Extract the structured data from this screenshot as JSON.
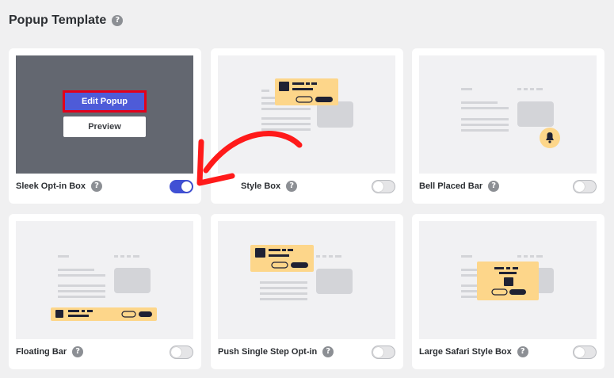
{
  "page": {
    "title": "Popup Template",
    "help_glyph": "?"
  },
  "cards": [
    {
      "name": "Sleek Opt-in Box",
      "enabled": true,
      "hovered": true
    },
    {
      "name": "Style Box",
      "enabled": false
    },
    {
      "name": "Bell Placed Bar",
      "enabled": false
    },
    {
      "name": "Floating Bar",
      "enabled": false
    },
    {
      "name": "Push Single Step Opt-in",
      "enabled": false
    },
    {
      "name": "Large Safari Style Box",
      "enabled": false
    }
  ],
  "hover_actions": {
    "edit_label": "Edit Popup",
    "preview_label": "Preview"
  },
  "colors": {
    "accent": "#4e5bd8",
    "toggle_on": "#4050d4",
    "highlight": "#e3001b",
    "popup_fill": "#fdd68a",
    "arrow": "#ff1a1a"
  },
  "icons": [
    "question-icon",
    "bell-icon",
    "red-arrow-annotation"
  ]
}
